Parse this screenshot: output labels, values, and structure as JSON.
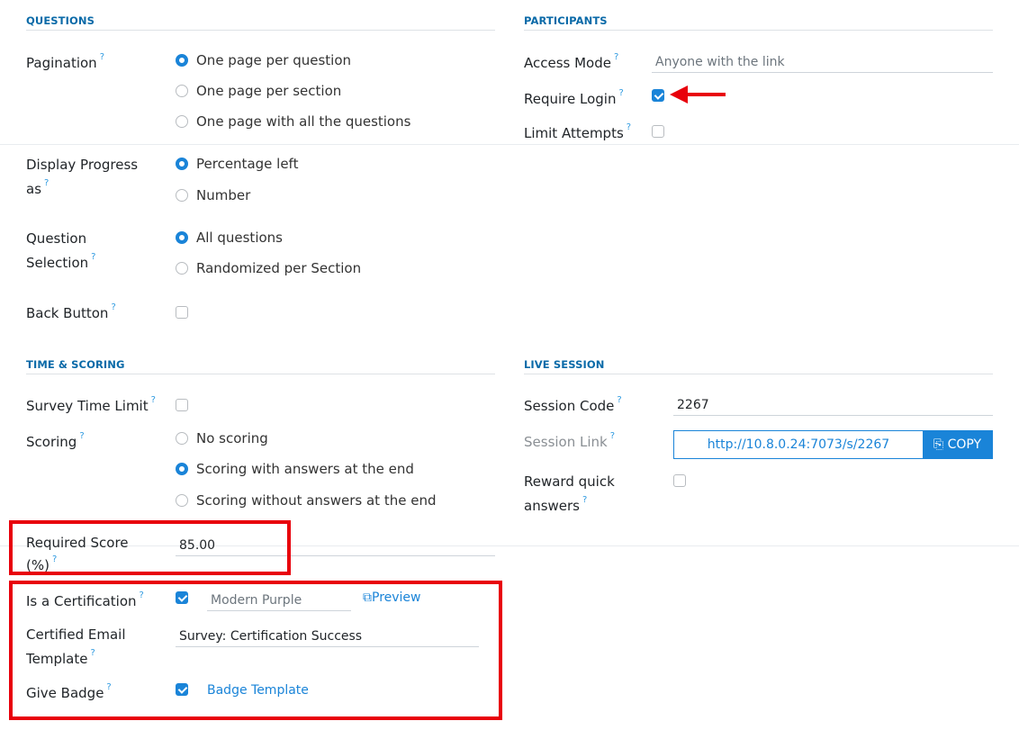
{
  "questions": {
    "title": "QUESTIONS",
    "pagination": {
      "label": "Pagination",
      "help": "?",
      "options": [
        "One page per question",
        "One page per section",
        "One page with all the questions"
      ],
      "selected": 0
    },
    "display_progress": {
      "label_line1": "Display Progress",
      "label_line2": "as",
      "help": "?",
      "options": [
        "Percentage left",
        "Number"
      ],
      "selected": 0
    },
    "question_selection": {
      "label_line1": "Question",
      "label_line2": "Selection",
      "help": "?",
      "options": [
        "All questions",
        "Randomized per Section"
      ],
      "selected": 0
    },
    "back_button": {
      "label": "Back Button",
      "help": "?",
      "checked": false
    }
  },
  "participants": {
    "title": "PARTICIPANTS",
    "access_mode": {
      "label": "Access Mode",
      "help": "?",
      "placeholder": "Anyone with the link"
    },
    "require_login": {
      "label": "Require Login",
      "help": "?",
      "checked": true
    },
    "limit_attempts": {
      "label": "Limit Attempts",
      "help": "?",
      "checked": false
    }
  },
  "time_scoring": {
    "title": "TIME & SCORING",
    "survey_time_limit": {
      "label": "Survey Time Limit",
      "help": "?",
      "checked": false
    },
    "scoring": {
      "label": "Scoring",
      "help": "?",
      "options": [
        "No scoring",
        "Scoring with answers at the end",
        "Scoring without answers at the end"
      ],
      "selected": 1
    },
    "required_score": {
      "label_line1": "Required Score",
      "label_line2": "(%)",
      "help": "?",
      "value": "85.00"
    },
    "is_certification": {
      "label": "Is a Certification",
      "help": "?",
      "checked": true,
      "template_placeholder": "Modern Purple",
      "preview_label": "Preview"
    },
    "certified_email": {
      "label_line1": "Certified Email",
      "label_line2": "Template",
      "help": "?",
      "value": "Survey: Certification Success"
    },
    "give_badge": {
      "label": "Give Badge",
      "help": "?",
      "checked": true,
      "link_label": "Badge Template"
    }
  },
  "live_session": {
    "title": "LIVE SESSION",
    "session_code": {
      "label": "Session Code",
      "help": "?",
      "value": "2267"
    },
    "session_link": {
      "label": "Session Link",
      "help": "?",
      "url": "http://10.8.0.24:7073/s/2267",
      "copy_label": "COPY"
    },
    "reward_quick": {
      "label_line1": "Reward quick",
      "label_line2": "answers",
      "help": "?",
      "checked": false
    }
  },
  "colors": {
    "accent": "#1a84d8",
    "highlight": "#e8000b"
  }
}
